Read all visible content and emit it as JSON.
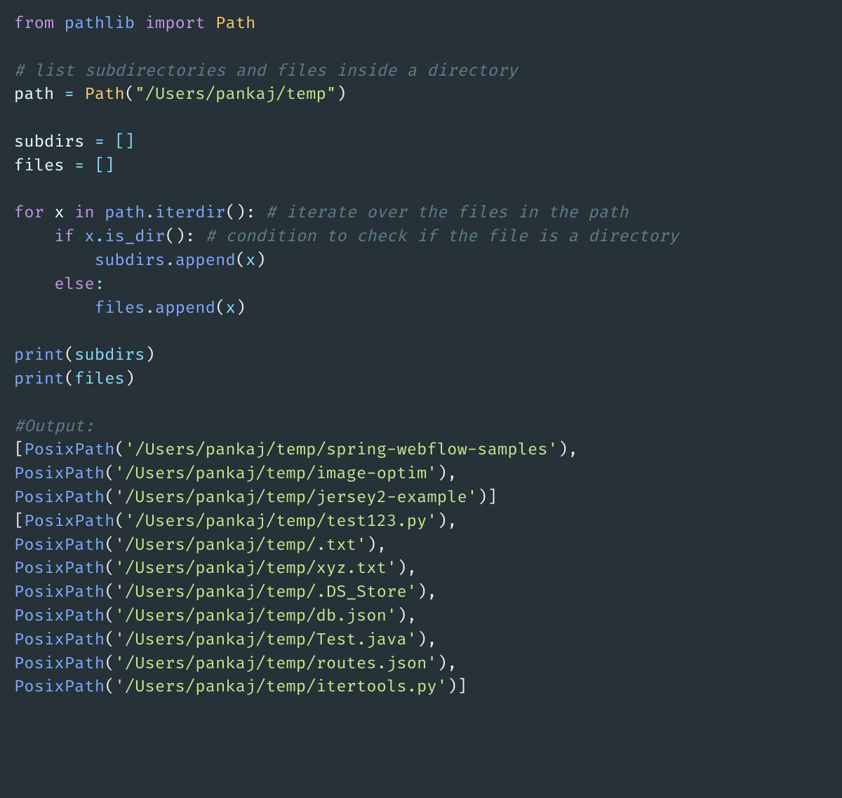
{
  "code": {
    "line1_from": "from",
    "line1_mod": "pathlib",
    "line1_import": "import",
    "line1_cls": "Path",
    "line3_comment": "# list subdirectories and files inside a directory",
    "line4_var": "path",
    "line4_eq": " = ",
    "line4_cls": "Path",
    "line4_open": "(",
    "line4_str": "\"/Users/pankaj/temp\"",
    "line4_close": ")",
    "line6_var": "subdirs",
    "line6_rest": " = []",
    "line7_var": "files",
    "line7_rest": " = []",
    "line9_for": "for",
    "line9_x": "x",
    "line9_in": "in",
    "line9_path": "path",
    "line9_dot": ".",
    "line9_iterdir": "iterdir",
    "line9_parens": "():",
    "line9_comment": "# iterate over the files in the path",
    "line10_indent": "    ",
    "line10_if": "if",
    "line10_x": "x",
    "line10_dot": ".",
    "line10_isdir": "is_dir",
    "line10_parens": "():",
    "line10_comment": "# condition to check if the file is a directory",
    "line11_indent": "        ",
    "line11_subdirs": "subdirs",
    "line11_dot": ".",
    "line11_append": "append",
    "line11_open": "(",
    "line11_x": "x",
    "line11_close": ")",
    "line12_indent": "    ",
    "line12_else": "else",
    "line12_colon": ":",
    "line13_indent": "        ",
    "line13_files": "files",
    "line13_dot": ".",
    "line13_append": "append",
    "line13_open": "(",
    "line13_x": "x",
    "line13_close": ")",
    "line15_print": "print",
    "line15_open": "(",
    "line15_arg": "subdirs",
    "line15_close": ")",
    "line16_print": "print",
    "line16_open": "(",
    "line16_arg": "files",
    "line16_close": ")",
    "line18_comment": "#Output:",
    "out1_open": "[",
    "out1_cls": "PosixPath",
    "out1_p": "(",
    "out1_str": "'/Users/pankaj/temp/spring-webflow-samples'",
    "out1_c": "),",
    "out2_cls": "PosixPath",
    "out2_p": "(",
    "out2_str": "'/Users/pankaj/temp/image-optim'",
    "out2_c": "),",
    "out3_cls": "PosixPath",
    "out3_p": "(",
    "out3_str": "'/Users/pankaj/temp/jersey2-example'",
    "out3_c": ")]",
    "out4_open": "[",
    "out4_cls": "PosixPath",
    "out4_p": "(",
    "out4_str": "'/Users/pankaj/temp/test123.py'",
    "out4_c": "),",
    "out5_cls": "PosixPath",
    "out5_p": "(",
    "out5_str": "'/Users/pankaj/temp/.txt'",
    "out5_c": "),",
    "out6_cls": "PosixPath",
    "out6_p": "(",
    "out6_str": "'/Users/pankaj/temp/xyz.txt'",
    "out6_c": "),",
    "out7_cls": "PosixPath",
    "out7_p": "(",
    "out7_str": "'/Users/pankaj/temp/.DS_Store'",
    "out7_c": "),",
    "out8_cls": "PosixPath",
    "out8_p": "(",
    "out8_str": "'/Users/pankaj/temp/db.json'",
    "out8_c": "),",
    "out9_cls": "PosixPath",
    "out9_p": "(",
    "out9_str": "'/Users/pankaj/temp/Test.java'",
    "out9_c": "),",
    "out10_cls": "PosixPath",
    "out10_p": "(",
    "out10_str": "'/Users/pankaj/temp/routes.json'",
    "out10_c": "),",
    "out11_cls": "PosixPath",
    "out11_p": "(",
    "out11_str": "'/Users/pankaj/temp/itertools.py'",
    "out11_c": ")]"
  }
}
